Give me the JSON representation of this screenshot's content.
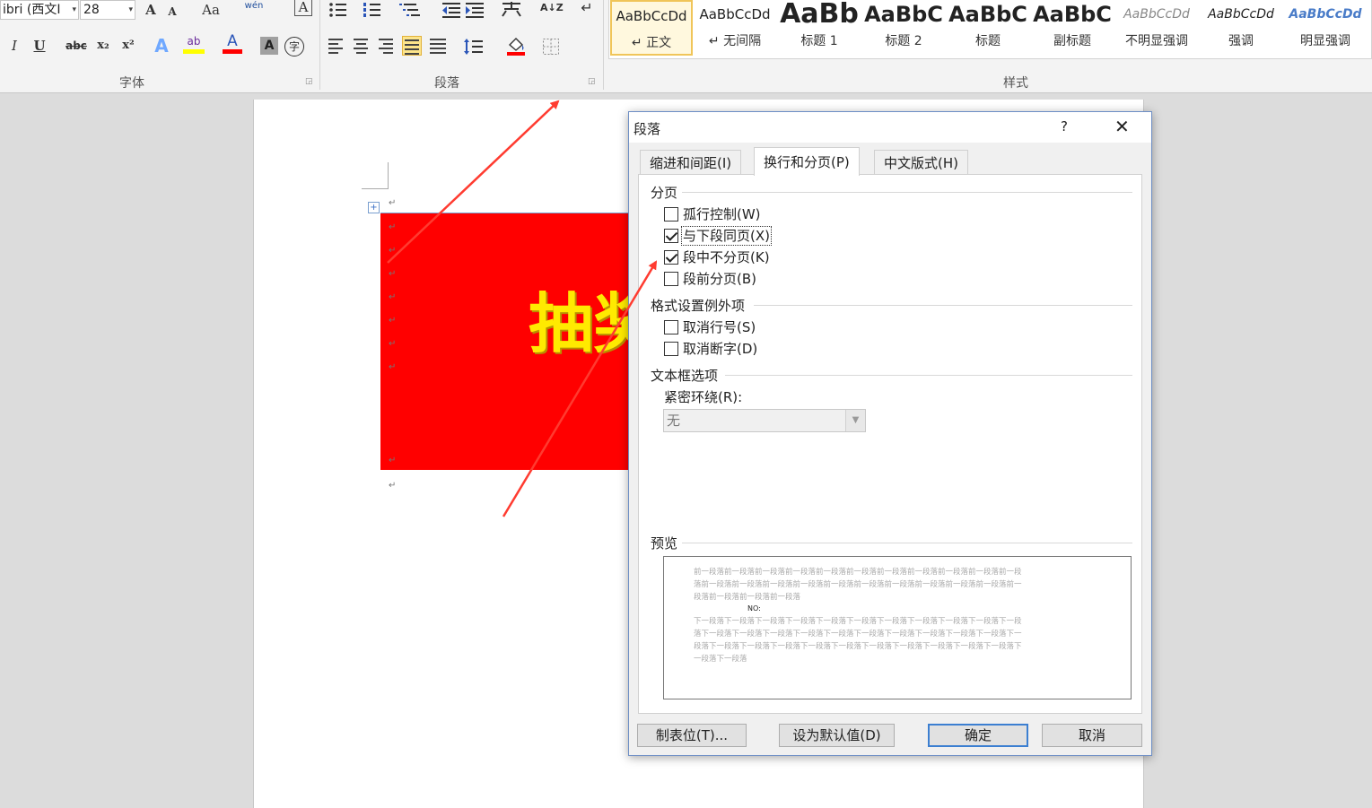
{
  "ribbon": {
    "font": {
      "group_label": "字体",
      "font_name": "ibri (西文I",
      "font_size": "28",
      "icons": [
        "grow-font-icon",
        "shrink-font-icon",
        "change-case-icon",
        "phonetic-guide-icon",
        "char-border-icon",
        "italic-icon",
        "underline-icon",
        "strikethrough-icon",
        "subscript-icon",
        "superscript-icon",
        "text-effects-icon",
        "highlight-icon",
        "font-color-icon",
        "char-shading-icon",
        "enclose-char-icon"
      ],
      "glyphs": {
        "grow": "A",
        "shrink": "A",
        "change_case": "Aa",
        "phonetic": "wén",
        "char_border": "A",
        "italic": "I",
        "underline": "U",
        "strike": "abc",
        "subscript": "x₂",
        "superscript": "x²",
        "effects": "A",
        "highlight": "ab",
        "color": "A",
        "shading": "A",
        "enclose": "字"
      },
      "colors": {
        "highlight": "#ffff00",
        "font_color": "#ff0000"
      }
    },
    "paragraph": {
      "group_label": "段落",
      "icons": [
        "bullets-icon",
        "numbering-icon",
        "multilevel-list-icon",
        "decrease-indent-icon",
        "increase-indent-icon",
        "asian-layout-icon",
        "sort-icon",
        "show-marks-icon",
        "align-left-icon",
        "align-center-icon",
        "align-right-icon",
        "justify-icon",
        "distributed-icon",
        "line-spacing-icon",
        "shading-icon",
        "borders-icon"
      ],
      "glyphs": {
        "sort": "A↓Z",
        "show_marks": "↵"
      },
      "active_alignment": "justify"
    },
    "styles": {
      "group_label": "样式",
      "items": [
        {
          "sample": "AaBbCcDd",
          "name": "↵ 正文",
          "selected": true
        },
        {
          "sample": "AaBbCcDd",
          "name": "↵ 无间隔"
        },
        {
          "sample": "AaBb",
          "name": "标题 1"
        },
        {
          "sample": "AaBbC",
          "name": "标题 2"
        },
        {
          "sample": "AaBbC",
          "name": "标题"
        },
        {
          "sample": "AaBbC",
          "name": "副标题"
        },
        {
          "sample": "AaBbCcDd",
          "name": "不明显强调"
        },
        {
          "sample": "AaBbCcDd",
          "name": "强调"
        },
        {
          "sample": "AaBbCcDd",
          "name": "明显强调"
        }
      ]
    }
  },
  "document": {
    "heading_text": "抽奖",
    "heading_color": "#ffea00",
    "box_color": "#ff0000",
    "paragraph_mark": "↵",
    "anchor_glyph": "+"
  },
  "dialog": {
    "title": "段落",
    "help": "?",
    "close": "✕",
    "tabs": [
      {
        "label": "缩进和间距(I)",
        "active": false
      },
      {
        "label": "换行和分页(P)",
        "active": true
      },
      {
        "label": "中文版式(H)",
        "active": false
      }
    ],
    "pagination": {
      "label": "分页",
      "options": [
        {
          "label": "孤行控制(W)",
          "checked": false
        },
        {
          "label": "与下段同页(X)",
          "checked": true
        },
        {
          "label": "段中不分页(K)",
          "checked": true
        },
        {
          "label": "段前分页(B)",
          "checked": false
        }
      ]
    },
    "exceptions": {
      "label": "格式设置例外项",
      "options": [
        {
          "label": "取消行号(S)",
          "checked": false
        },
        {
          "label": "取消断字(D)",
          "checked": false
        }
      ]
    },
    "textbox": {
      "label": "文本框选项",
      "wrap_label": "紧密环绕(R):",
      "wrap_value": "无"
    },
    "preview": {
      "label": "预览",
      "prev_lines": [
        "前一段落前一段落前一段落前一段落前一段落前一段落前一段落前一段落前一段落前一段落前一段",
        "落前一段落前一段落前一段落前一段落前一段落前一段落前一段落前一段落前一段落前一段落前一",
        "段落前一段落前一段落前一段落"
      ],
      "current": "NO:",
      "next_lines": [
        "下一段落下一段落下一段落下一段落下一段落下一段落下一段落下一段落下一段落下一段落下一段",
        "落下一段落下一段落下一段落下一段落下一段落下一段落下一段落下一段落下一段落下一段落下一",
        "段落下一段落下一段落下一段落下一段落下一段落下一段落下一段落下一段落下一段落下一段落下",
        "一段落下一段落"
      ]
    },
    "buttons": {
      "tabs": "制表位(T)...",
      "default": "设为默认值(D)",
      "ok": "确定",
      "cancel": "取消"
    }
  },
  "annotations": {
    "arrow_color": "#ff3b30"
  }
}
